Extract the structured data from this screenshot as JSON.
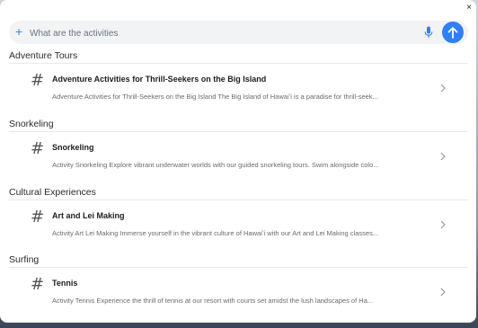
{
  "window": {
    "close_label": "×"
  },
  "search": {
    "placeholder": "What are the activities",
    "plus_icon": "plus-icon",
    "mic_icon": "microphone-icon",
    "send_icon": "arrow-up-icon",
    "accent_color": "#2f7ff5"
  },
  "sections": [
    {
      "title": "Adventure Tours",
      "items": [
        {
          "icon": "#",
          "title": "Adventure Activities for Thrill-Seekers on the Big Island",
          "description": "Adventure Activities for Thrill-Seekers on the Big Island The Big Island of Hawaiʻi is a paradise for thrill-seek..."
        }
      ]
    },
    {
      "title": "Snorkeling",
      "items": [
        {
          "icon": "#",
          "title": "Snorkeling",
          "description": "Activity Snorkeling Explore vibrant underwater worlds with our guided snorkeling tours. Swim alongside colo..."
        }
      ]
    },
    {
      "title": "Cultural Experiences",
      "items": [
        {
          "icon": "#",
          "title": "Art and Lei Making",
          "description": "Activity Art Lei Making Immerse yourself in the vibrant culture of Hawaiʻi with our Art and Lei Making classes..."
        }
      ]
    },
    {
      "title": "Surfing",
      "items": [
        {
          "icon": "#",
          "title": "Tennis",
          "description": "Activity Tennis Experience the thrill of tennis at our resort with courts set amidst the lush landscapes of Ha..."
        }
      ]
    }
  ]
}
